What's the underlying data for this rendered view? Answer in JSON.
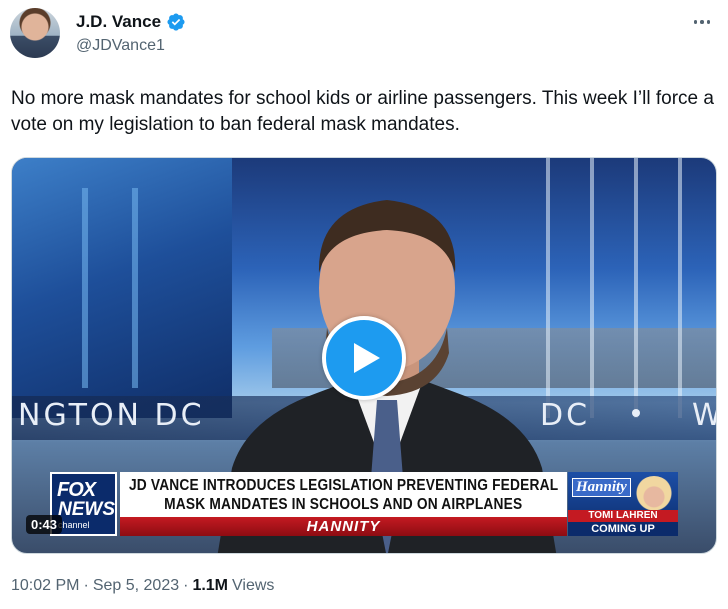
{
  "author": {
    "display_name": "J.D. Vance",
    "handle": "@JDVance1",
    "verified": true,
    "avatar_icon": "profile-photo-icon"
  },
  "tweet": {
    "text": "No more mask mandates for school kids or airline passengers. This week I’ll force a vote on my legislation to ban federal mask mandates."
  },
  "media": {
    "type": "video",
    "duration": "0:43",
    "background_text_left": "NGTON DC",
    "background_text_right": "DC",
    "background_text_far_right": "W",
    "network_logo_line1": "FOX",
    "network_logo_line2": "NEWS",
    "network_logo_line3": "channel",
    "headline_line1": "JD VANCE INTRODUCES LEGISLATION PREVENTING FEDERAL",
    "headline_line2": "MASK MANDATES IN SCHOOLS AND ON AIRPLANES",
    "show_name": "HANNITY",
    "promo_show": "Hannity",
    "promo_name": "TOMI LAHREN",
    "promo_status": "COMING UP"
  },
  "meta": {
    "time": "10:02 PM",
    "separator": "·",
    "date": "Sep 5, 2023",
    "views_count": "1.1M",
    "views_label": "Views"
  },
  "colors": {
    "accent": "#1d9bf0",
    "text_primary": "#0f1419",
    "text_secondary": "#536471",
    "fox_red": "#c41a22",
    "fox_blue": "#0b2b6b"
  }
}
